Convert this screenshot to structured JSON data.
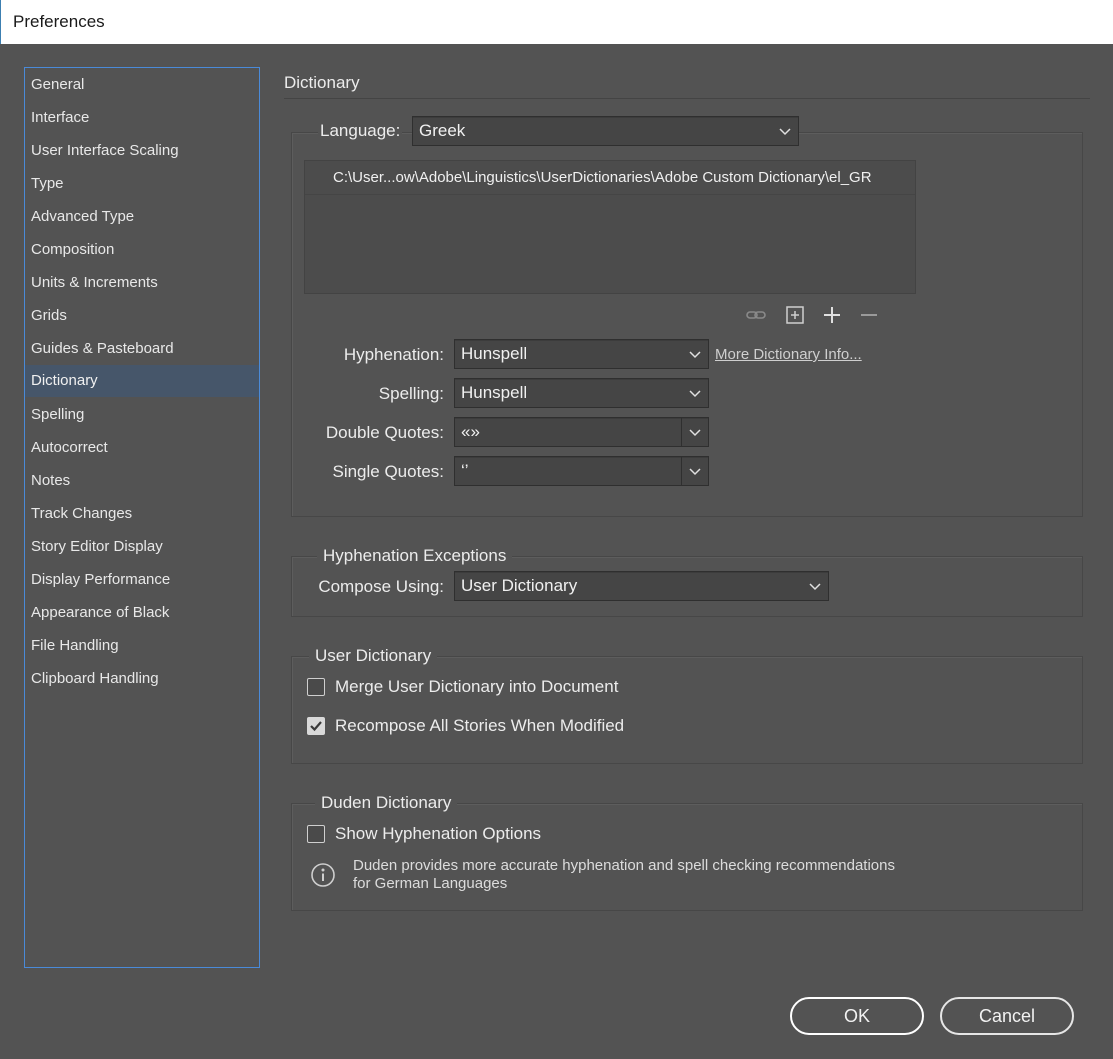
{
  "window": {
    "title": "Preferences"
  },
  "sidebar": {
    "items": [
      "General",
      "Interface",
      "User Interface Scaling",
      "Type",
      "Advanced Type",
      "Composition",
      "Units & Increments",
      "Grids",
      "Guides & Pasteboard",
      "Dictionary",
      "Spelling",
      "Autocorrect",
      "Notes",
      "Track Changes",
      "Story Editor Display",
      "Display Performance",
      "Appearance of Black",
      "File Handling",
      "Clipboard Handling"
    ],
    "selected": "Dictionary"
  },
  "page": {
    "heading": "Dictionary"
  },
  "language": {
    "label": "Language:",
    "value": "Greek",
    "dictionary_path": "C:\\User...ow\\Adobe\\Linguistics\\UserDictionaries\\Adobe Custom Dictionary\\el_GR",
    "tools": [
      "link-icon",
      "new-dictionary-icon",
      "add-icon",
      "remove-icon"
    ]
  },
  "hyphenation": {
    "label": "Hyphenation:",
    "value": "Hunspell",
    "more_info_link": "More Dictionary Info..."
  },
  "spelling": {
    "label": "Spelling:",
    "value": "Hunspell"
  },
  "double_quotes": {
    "label": "Double Quotes:",
    "value": "«»"
  },
  "single_quotes": {
    "label": "Single Quotes:",
    "value": "‘’"
  },
  "hyphenation_exceptions": {
    "group_label": "Hyphenation Exceptions",
    "compose_label": "Compose Using:",
    "compose_value": "User Dictionary"
  },
  "user_dictionary": {
    "group_label": "User Dictionary",
    "merge_label": "Merge User Dictionary into Document",
    "merge_checked": false,
    "recompose_label": "Recompose All Stories When Modified",
    "recompose_checked": true
  },
  "duden": {
    "group_label": "Duden Dictionary",
    "show_label": "Show Hyphenation Options",
    "show_checked": false,
    "info_line1": "Duden provides more accurate hyphenation and spell checking recommendations",
    "info_line2": "for German Languages"
  },
  "buttons": {
    "ok": "OK",
    "cancel": "Cancel"
  },
  "colors": {
    "background": "#535353",
    "selected_item": "#46566a",
    "sidebar_border": "#4a8ad8"
  }
}
